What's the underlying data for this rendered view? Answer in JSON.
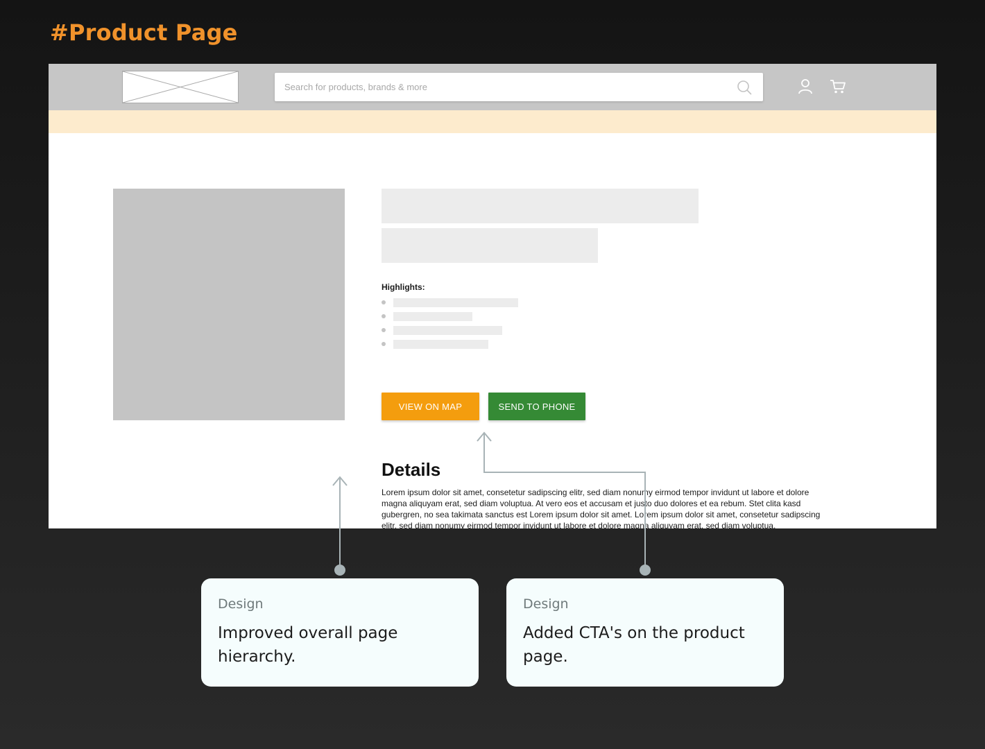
{
  "heading": "#Product Page",
  "header": {
    "search": {
      "placeholder": "Search for products, brands & more"
    },
    "icons": {
      "search": "search-icon",
      "user": "user-icon",
      "cart": "cart-icon"
    }
  },
  "product": {
    "highlights_label": "Highlights:",
    "buttons": {
      "view_on_map": "VIEW ON MAP",
      "send_to_phone": "SEND TO PHONE"
    },
    "details_title": "Details",
    "details_text": "Lorem ipsum dolor sit amet, consetetur sadipscing elitr, sed diam nonumy eirmod tempor invidunt ut labore et dolore magna aliquyam erat, sed diam voluptua. At vero eos et accusam et justo duo dolores et ea rebum. Stet clita kasd gubergren, no sea takimata sanctus est Lorem ipsum dolor sit amet. Lorem ipsum dolor sit amet, consetetur sadipscing elitr, sed diam nonumy eirmod tempor invidunt ut labore et dolore magna aliquyam erat, sed diam voluptua."
  },
  "annotations": [
    {
      "tag": "Design",
      "text": "Improved overall page hierarchy."
    },
    {
      "tag": "Design",
      "text": "Added CTA's on the product page."
    }
  ],
  "colors": {
    "heading": "#f0922b",
    "view_on_map": "#f49d0e",
    "send_to_phone": "#358a35",
    "promo_strip": "#fdebcd",
    "topbar": "#c6c6c6",
    "card_bg": "#f5fdfd"
  }
}
